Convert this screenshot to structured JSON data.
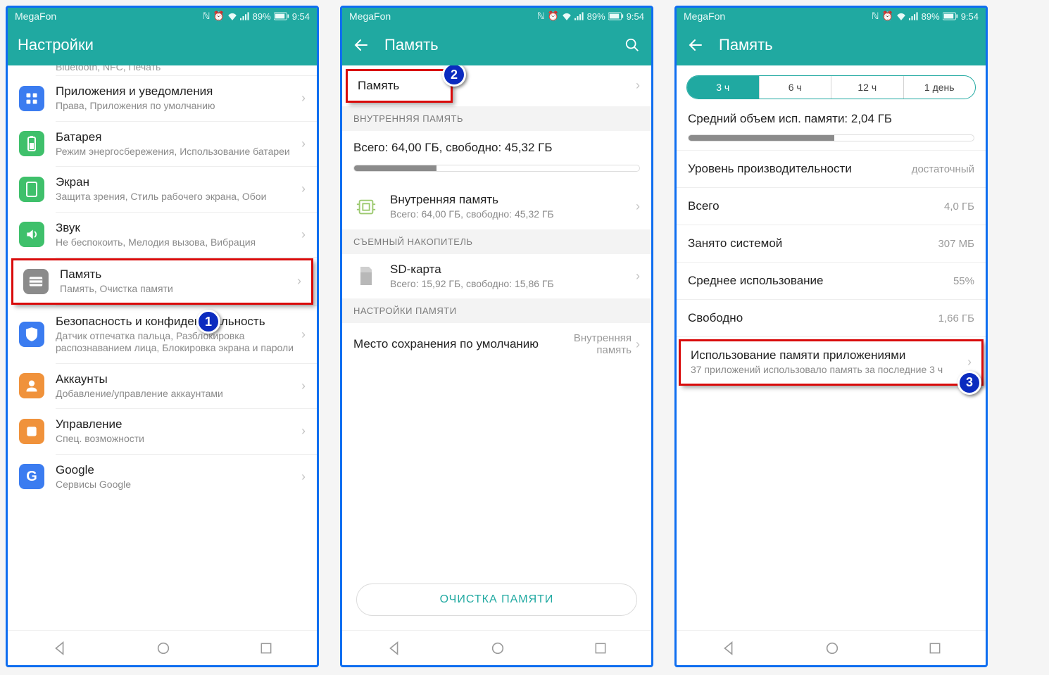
{
  "status": {
    "carrier": "MegaFon",
    "battery": "89%",
    "time": "9:54"
  },
  "p1": {
    "title": "Настройки",
    "truncated_top": "Bluetooth, NFC, Печать",
    "rows": [
      {
        "icon": "apps",
        "bg": "#3b7cf0",
        "title": "Приложения и уведомления",
        "sub": "Права, Приложения по умолчанию"
      },
      {
        "icon": "battery",
        "bg": "#3fc06b",
        "title": "Батарея",
        "sub": "Режим энергосбережения, Использование батареи"
      },
      {
        "icon": "screen",
        "bg": "#3fc06b",
        "title": "Экран",
        "sub": "Защита зрения, Стиль рабочего экрана, Обои"
      },
      {
        "icon": "sound",
        "bg": "#3fc06b",
        "title": "Звук",
        "sub": "Не беспокоить, Мелодия вызова, Вибрация"
      },
      {
        "icon": "memory",
        "bg": "#8b8b8b",
        "title": "Память",
        "sub": "Память, Очистка памяти",
        "hl": true
      },
      {
        "icon": "shield",
        "bg": "#3b7cf0",
        "title": "Безопасность и конфиденциальность",
        "sub": "Датчик отпечатка пальца, Разблокировка распознаванием лица, Блокировка экрана и пароли"
      },
      {
        "icon": "account",
        "bg": "#f0923b",
        "title": "Аккаунты",
        "sub": "Добавление/управление аккаунтами"
      },
      {
        "icon": "manage",
        "bg": "#f0923b",
        "title": "Управление",
        "sub": "Спец. возможности"
      },
      {
        "icon": "google",
        "bg": "#3b7cf0",
        "title": "Google",
        "sub": "Сервисы Google"
      }
    ],
    "badge": "1"
  },
  "p2": {
    "title": "Память",
    "mem_row": "Память",
    "sec_internal": "ВНУТРЕННЯЯ ПАМЯТЬ",
    "summary": "Всего: 64,00 ГБ, свободно: 45,32 ГБ",
    "used_pct": 29,
    "internal": {
      "title": "Внутренняя память",
      "sub": "Всего: 64,00 ГБ, свободно: 45,32 ГБ"
    },
    "sec_ext": "СЪЕМНЫЙ НАКОПИТЕЛЬ",
    "sd": {
      "title": "SD-карта",
      "sub": "Всего: 15,92 ГБ, свободно: 15,86 ГБ"
    },
    "sec_settings": "НАСТРОЙКИ ПАМЯТИ",
    "default_loc": {
      "title": "Место сохранения по умолчанию",
      "value": "Внутренняя память"
    },
    "cleanup": "ОЧИСТКА ПАМЯТИ",
    "badge": "2"
  },
  "p3": {
    "title": "Память",
    "seg": [
      "3 ч",
      "6 ч",
      "12 ч",
      "1 день"
    ],
    "seg_active": 0,
    "avg_label": "Средний объем исп. памяти: 2,04 ГБ",
    "avg_pct": 51,
    "rows": [
      {
        "k": "Уровень производительности",
        "v": "достаточный"
      },
      {
        "k": "Всего",
        "v": "4,0 ГБ"
      },
      {
        "k": "Занято системой",
        "v": "307 МБ"
      },
      {
        "k": "Среднее использование",
        "v": "55%"
      },
      {
        "k": "Свободно",
        "v": "1,66 ГБ"
      }
    ],
    "appuse": {
      "title": "Использование памяти приложениями",
      "sub": "37 приложений использовало память за последние 3 ч"
    },
    "badge": "3"
  }
}
